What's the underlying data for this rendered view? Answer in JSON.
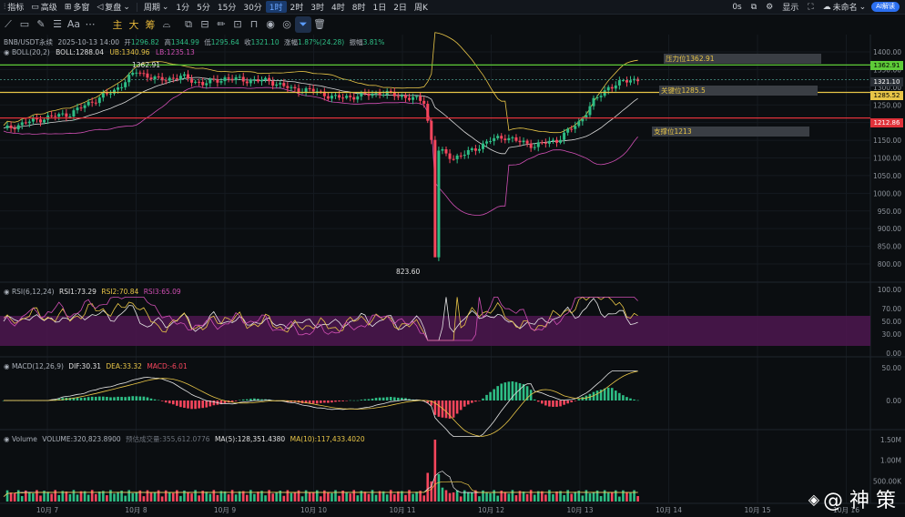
{
  "topbar": {
    "items": [
      "指标",
      "高级",
      "多窗",
      "复盘"
    ],
    "period_label": "周期",
    "intervals": [
      "1分",
      "5分",
      "15分",
      "30分",
      "1时",
      "2时",
      "3时",
      "4时",
      "8时",
      "1日",
      "2日",
      "周K"
    ],
    "active_interval": "1时",
    "right": {
      "time_label": "0s",
      "display_label": "显示",
      "unnamed_label": "未命名",
      "ai_label": "AI解读"
    }
  },
  "toolbar2": {
    "cjk_buttons": [
      "主",
      "大",
      "筹"
    ]
  },
  "main_legend": {
    "symbol": "BNB/USDT永续",
    "datetime": "2025-10-13 14:00",
    "open_label": "开",
    "open": "1296.82",
    "high_label": "高",
    "high": "1344.99",
    "low_label": "低",
    "low": "1295.64",
    "close_label": "收",
    "close": "1321.10",
    "change_label": "涨幅",
    "change": "1.87%(24.28)",
    "amp_label": "振幅",
    "amp": "3.81%",
    "boll_name": "BOLL(20,2)",
    "boll_text": "BOLL:1288.04",
    "ub_text": "UB:1340.96",
    "lb_text": "LB:1235.13"
  },
  "levels": {
    "resistance_label": "压力位1362.91",
    "key_label": "关键位1285.5",
    "support_label": "支撑位1213",
    "tag_1362": "1362.91",
    "tag_1321": "1321.10",
    "tag_1285": "1285.52",
    "tag_1212": "1212.86"
  },
  "annotations": {
    "high": "1362.91",
    "low": "823.60"
  },
  "rsi_legend": {
    "name": "RSI(6,12,24)",
    "rsi1": "RSI1:73.29",
    "rsi2": "RSI2:70.84",
    "rsi3": "RSI3:65.09"
  },
  "macd_legend": {
    "name": "MACD(12,26,9)",
    "dif": "DIF:30.31",
    "dea": "DEA:33.32",
    "macd": "MACD:-6.01"
  },
  "vol_legend": {
    "name": "Volume",
    "volume": "VOLUME:320,823.8900",
    "est": "预估成交量:355,612.0776",
    "ma5": "MA(5):128,351.4380",
    "ma10": "MA(10):117,433.4020"
  },
  "price_axis": [
    "1400.00",
    "1350.00",
    "1300.00",
    "1250.00",
    "1200.00",
    "1150.00",
    "1100.00",
    "1050.00",
    "1000.00",
    "950.00",
    "900.00",
    "850.00",
    "800.00"
  ],
  "rsi_axis": [
    "100.00",
    "70.00",
    "50.00",
    "30.00",
    "0.00"
  ],
  "macd_axis": [
    "50.00",
    "0.00"
  ],
  "vol_axis": [
    "1.50M",
    "1.00M",
    "500.00K"
  ],
  "x_axis": [
    "10月 7",
    "10月 8",
    "10月 9",
    "10月 10",
    "10月 11",
    "10月 12",
    "10月 13",
    "10月 14",
    "10月 15",
    "10月 16"
  ],
  "watermark": "@ 神 策",
  "colors": {
    "up": "#2ebd85",
    "down": "#f6465d",
    "yellow": "#e8c547",
    "green_line": "#5ecb38",
    "red_line": "#e0323a",
    "rsi_band": "#5a1a5a"
  },
  "chart_data": {
    "type": "candlestick",
    "symbol": "BNB/USDT",
    "interval": "1h",
    "ylim": [
      800,
      1410
    ],
    "close_path": [
      [
        0,
        1180
      ],
      [
        6,
        1200
      ],
      [
        12,
        1215
      ],
      [
        18,
        1225
      ],
      [
        24,
        1260
      ],
      [
        30,
        1290
      ],
      [
        36,
        1345
      ],
      [
        42,
        1320
      ],
      [
        48,
        1330
      ],
      [
        54,
        1310
      ],
      [
        60,
        1325
      ],
      [
        66,
        1320
      ],
      [
        72,
        1318
      ],
      [
        78,
        1295
      ],
      [
        84,
        1290
      ],
      [
        90,
        1270
      ],
      [
        96,
        1275
      ],
      [
        102,
        1285
      ],
      [
        108,
        1275
      ],
      [
        114,
        1260
      ],
      [
        116,
        1150
      ],
      [
        117,
        823.6
      ],
      [
        118,
        1120
      ],
      [
        122,
        1100
      ],
      [
        126,
        1115
      ],
      [
        132,
        1150
      ],
      [
        136,
        1160
      ],
      [
        140,
        1145
      ],
      [
        144,
        1135
      ],
      [
        150,
        1150
      ],
      [
        156,
        1200
      ],
      [
        160,
        1260
      ],
      [
        164,
        1300
      ],
      [
        170,
        1322
      ],
      [
        172,
        1321.1
      ]
    ],
    "levels": {
      "resistance": 1362.91,
      "key": 1285.5,
      "support": 1213,
      "last": 1321.1,
      "key_tag": 1285.52,
      "support_tag": 1212.86
    },
    "last_bar": {
      "open": 1296.82,
      "high": 1344.99,
      "low": 1295.64,
      "close": 1321.1
    },
    "boll": {
      "mid": 1288.04,
      "ub": 1340.96,
      "lb": 1235.13
    },
    "rsi": {
      "rsi1": 73.29,
      "rsi2": 70.84,
      "rsi3": 65.09
    },
    "macd": {
      "dif": 30.31,
      "dea": 33.32,
      "macd": -6.01
    },
    "volume": {
      "last": 320823.89,
      "est": 355612.0776,
      "ma5": 128351.438,
      "ma10": 117433.402
    }
  }
}
